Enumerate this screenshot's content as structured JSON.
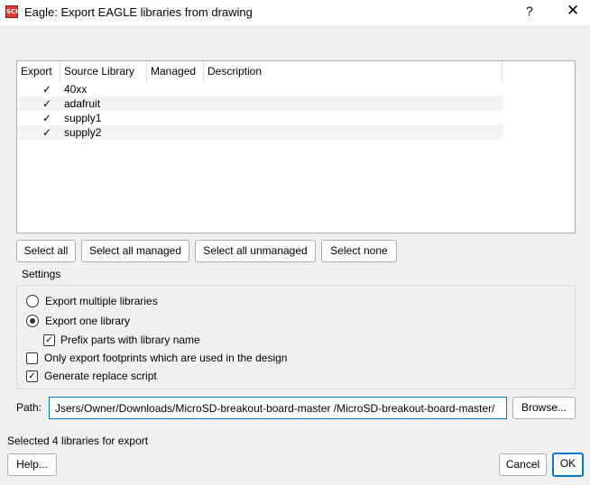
{
  "window": {
    "title": "Eagle: Export EAGLE libraries from drawing",
    "icon_text": "SCH",
    "help_glyph": "?",
    "close_glyph": "✕"
  },
  "table": {
    "columns": [
      "Export",
      "Source Library",
      "Managed",
      "Description"
    ],
    "rows": [
      {
        "export": "✓",
        "name": "40xx",
        "managed": "",
        "description": ""
      },
      {
        "export": "✓",
        "name": "adafruit",
        "managed": "",
        "description": ""
      },
      {
        "export": "✓",
        "name": "supply1",
        "managed": "",
        "description": ""
      },
      {
        "export": "✓",
        "name": "supply2",
        "managed": "",
        "description": ""
      }
    ]
  },
  "selection_buttons": {
    "select_all": "Select all",
    "select_all_managed": "Select all managed",
    "select_all_unmanaged": "Select all unmanaged",
    "select_none": "Select none"
  },
  "settings": {
    "label": "Settings",
    "export_multiple": {
      "label": "Export multiple libraries",
      "selected": false
    },
    "export_one": {
      "label": "Export one library",
      "selected": true
    },
    "prefix_parts": {
      "label": "Prefix parts with library name",
      "checked": true,
      "check": "✓"
    },
    "only_used_footprints": {
      "label": "Only export footprints which are used in the design",
      "checked": false,
      "check": ""
    },
    "generate_script": {
      "label": "Generate replace script",
      "checked": true,
      "check": "✓"
    }
  },
  "path": {
    "label": "Path:",
    "value": "Jsers/Owner/Downloads/MicroSD-breakout-board-master /MicroSD-breakout-board-master/",
    "browse_label": "Browse..."
  },
  "status_text": "Selected 4 libraries for export",
  "footer": {
    "help_label": "Help...",
    "cancel_label": "Cancel",
    "ok_label": "OK"
  },
  "colors": {
    "accent": "#0078d7",
    "window_bg": "#f0f0f0",
    "alt_row": "#f3f3f3"
  }
}
